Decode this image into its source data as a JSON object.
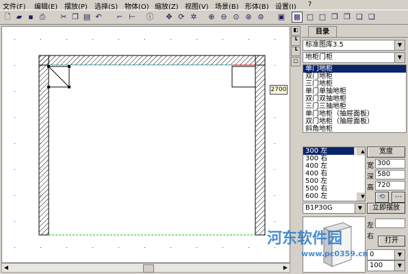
{
  "menu": [
    "文件(F)",
    "编辑(E)",
    "摆放(P)",
    "选择(S)",
    "物体(O)",
    "缩放(Z)",
    "视图(V)",
    "场景(B)",
    "形体(B)",
    "设置(I)",
    "?"
  ],
  "toolbar_icons": [
    "new-icon",
    "open-icon",
    "save-icon",
    "print-icon",
    "cut-icon",
    "copy-icon",
    "paste-icon",
    "undo-icon",
    "wall-icon",
    "dimension-icon",
    "info-icon",
    "move-icon",
    "rotate-icon",
    "rotate2-icon",
    "zoom-in-icon",
    "zoom-out-icon",
    "zoom-window-icon",
    "zoom-fit-icon",
    "zoom-all-icon",
    "render-icon",
    "view-plan-icon",
    "view-box1-icon",
    "view-box2-icon",
    "view-box3-icon",
    "view-box4-icon",
    "view-box5-icon",
    "view-box6-icon"
  ],
  "canvas": {
    "dimension_label": "2700"
  },
  "panel": {
    "tab_label": "目录",
    "library_select": "标准图库3.5",
    "category_select": "地柜门柜",
    "cabinet_list": [
      "单门地柜",
      "双门地柜",
      "三门地柜",
      "单门单抽地柜",
      "双门双抽地柜",
      "三门三抽地柜",
      "单门地柜（抽屉面板）",
      "双门地柜（抽屉面板）",
      "斜角地柜"
    ],
    "cabinet_selected": 0,
    "size_list": [
      "300 左",
      "300 右",
      "400 左",
      "400 右",
      "500 左",
      "500 右",
      "600 左",
      "600 右"
    ],
    "size_selected": 0,
    "width_button": "宽度",
    "width_label": "宽",
    "width_value": "300",
    "depth_label": "深",
    "depth_value": "580",
    "height_label": "高",
    "height_value": "720",
    "code_select": "B1P30G",
    "place_button": "立即摆放",
    "left_label": "左",
    "right_label": "右",
    "open_button": "打开",
    "bottom_select_value": "100",
    "bottom_select2_value": "0"
  },
  "watermark": {
    "text": "河东软件园",
    "url": "www.pc0359.cn"
  }
}
